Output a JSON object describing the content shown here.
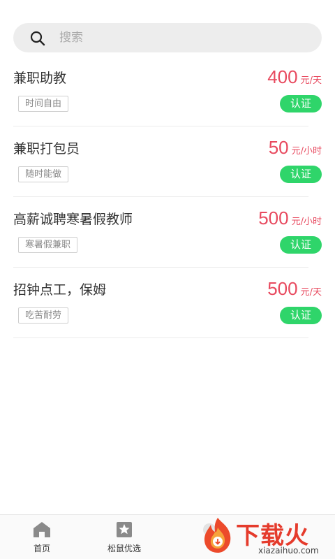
{
  "search": {
    "placeholder": "搜索"
  },
  "jobs": [
    {
      "title": "兼职助教",
      "tag": "时间自由",
      "amount": "400",
      "unit": "元/天",
      "badge": "认证"
    },
    {
      "title": "兼职打包员",
      "tag": "随时能做",
      "amount": "50",
      "unit": "元/小时",
      "badge": "认证"
    },
    {
      "title": "高薪诚聘寒暑假教师",
      "tag": "寒暑假兼职",
      "amount": "500",
      "unit": "元/小时",
      "badge": "认证"
    },
    {
      "title": "招钟点工，保姆",
      "tag": "吃苦耐劳",
      "amount": "500",
      "unit": "元/天",
      "badge": "认证"
    }
  ],
  "tabbar": {
    "home": {
      "label": "首页",
      "icon": "home-icon"
    },
    "featured": {
      "label": "松鼠优选",
      "icon": "star-bookmark-icon"
    }
  },
  "watermark": {
    "text": "下载火",
    "url": "xiazaihuo.com"
  },
  "colors": {
    "price": "#e84a5f",
    "badge": "#2fd56a",
    "search_bg": "#ededed"
  }
}
